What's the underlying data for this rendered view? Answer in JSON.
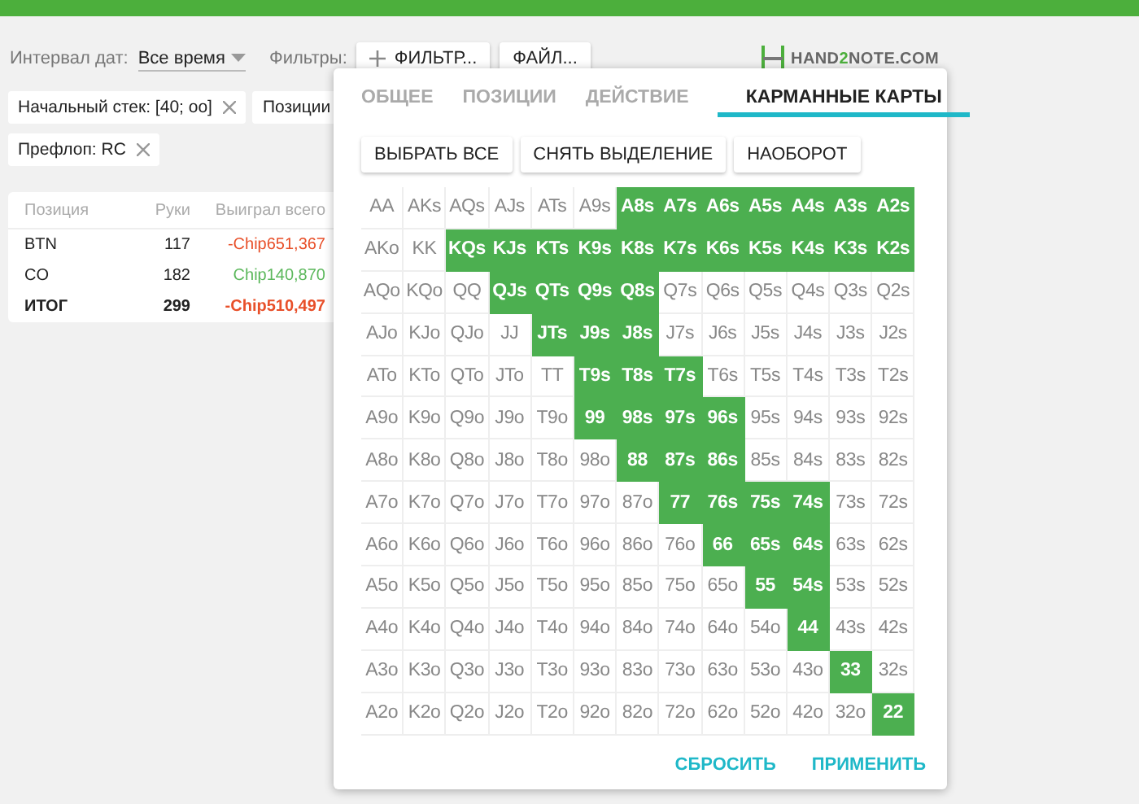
{
  "toolbar": {
    "date_label": "Интервал дат:",
    "date_value": "Все время",
    "filters_label": "Фильтры:",
    "filter_button": "ФИЛЬТР...",
    "file_button": "ФАЙЛ..."
  },
  "logo": {
    "before": "HAND",
    "mark": "2",
    "after": "NOTE.COM"
  },
  "chips": [
    {
      "label": "Начальный стек: [40; oo]",
      "closable": true
    },
    {
      "label": "Позиции",
      "closable": false
    },
    {
      "label": "Префлоп: RC",
      "closable": true
    }
  ],
  "table": {
    "columns": [
      "Позиция",
      "Руки",
      "Выиграл всего"
    ],
    "rows": [
      {
        "kind": "position",
        "position": "BTN",
        "hands": "117",
        "won": "-Chip651,367",
        "color": "#e8502a"
      },
      {
        "kind": "position",
        "position": "CO",
        "hands": "182",
        "won": "Chip140,870",
        "color": "#5cb85c"
      },
      {
        "kind": "total",
        "position": "ИТОГ",
        "hands": "299",
        "won": "-Chip510,497",
        "color": "#e8502a"
      }
    ]
  },
  "popup": {
    "tabs": [
      {
        "label": "ОБЩЕЕ",
        "selected": false
      },
      {
        "label": "ПОЗИЦИИ",
        "selected": false
      },
      {
        "label": "ДЕЙСТВИЕ",
        "selected": false
      },
      {
        "label": "КАРМАННЫЕ КАРТЫ",
        "selected": true
      }
    ],
    "actions": [
      "ВЫБРАТЬ ВСЕ",
      "СНЯТЬ ВЫДЕЛЕНИЕ",
      "НАОБОРОТ"
    ],
    "grid": [
      [
        {
          "label": "AA",
          "selected": false
        },
        {
          "label": "AKs",
          "selected": false
        },
        {
          "label": "AQs",
          "selected": false
        },
        {
          "label": "AJs",
          "selected": false
        },
        {
          "label": "ATs",
          "selected": false
        },
        {
          "label": "A9s",
          "selected": false
        },
        {
          "label": "A8s",
          "selected": true
        },
        {
          "label": "A7s",
          "selected": true
        },
        {
          "label": "A6s",
          "selected": true
        },
        {
          "label": "A5s",
          "selected": true
        },
        {
          "label": "A4s",
          "selected": true
        },
        {
          "label": "A3s",
          "selected": true
        },
        {
          "label": "A2s",
          "selected": true
        }
      ],
      [
        {
          "label": "AKo",
          "selected": false
        },
        {
          "label": "KK",
          "selected": false
        },
        {
          "label": "KQs",
          "selected": true
        },
        {
          "label": "KJs",
          "selected": true
        },
        {
          "label": "KTs",
          "selected": true
        },
        {
          "label": "K9s",
          "selected": true
        },
        {
          "label": "K8s",
          "selected": true
        },
        {
          "label": "K7s",
          "selected": true
        },
        {
          "label": "K6s",
          "selected": true
        },
        {
          "label": "K5s",
          "selected": true
        },
        {
          "label": "K4s",
          "selected": true
        },
        {
          "label": "K3s",
          "selected": true
        },
        {
          "label": "K2s",
          "selected": true
        }
      ],
      [
        {
          "label": "AQo",
          "selected": false
        },
        {
          "label": "KQo",
          "selected": false
        },
        {
          "label": "QQ",
          "selected": false
        },
        {
          "label": "QJs",
          "selected": true
        },
        {
          "label": "QTs",
          "selected": true
        },
        {
          "label": "Q9s",
          "selected": true
        },
        {
          "label": "Q8s",
          "selected": true
        },
        {
          "label": "Q7s",
          "selected": false
        },
        {
          "label": "Q6s",
          "selected": false
        },
        {
          "label": "Q5s",
          "selected": false
        },
        {
          "label": "Q4s",
          "selected": false
        },
        {
          "label": "Q3s",
          "selected": false
        },
        {
          "label": "Q2s",
          "selected": false
        }
      ],
      [
        {
          "label": "AJo",
          "selected": false
        },
        {
          "label": "KJo",
          "selected": false
        },
        {
          "label": "QJo",
          "selected": false
        },
        {
          "label": "JJ",
          "selected": false
        },
        {
          "label": "JTs",
          "selected": true
        },
        {
          "label": "J9s",
          "selected": true
        },
        {
          "label": "J8s",
          "selected": true
        },
        {
          "label": "J7s",
          "selected": false
        },
        {
          "label": "J6s",
          "selected": false
        },
        {
          "label": "J5s",
          "selected": false
        },
        {
          "label": "J4s",
          "selected": false
        },
        {
          "label": "J3s",
          "selected": false
        },
        {
          "label": "J2s",
          "selected": false
        }
      ],
      [
        {
          "label": "ATo",
          "selected": false
        },
        {
          "label": "KTo",
          "selected": false
        },
        {
          "label": "QTo",
          "selected": false
        },
        {
          "label": "JTo",
          "selected": false
        },
        {
          "label": "TT",
          "selected": false
        },
        {
          "label": "T9s",
          "selected": true
        },
        {
          "label": "T8s",
          "selected": true
        },
        {
          "label": "T7s",
          "selected": true
        },
        {
          "label": "T6s",
          "selected": false
        },
        {
          "label": "T5s",
          "selected": false
        },
        {
          "label": "T4s",
          "selected": false
        },
        {
          "label": "T3s",
          "selected": false
        },
        {
          "label": "T2s",
          "selected": false
        }
      ],
      [
        {
          "label": "A9o",
          "selected": false
        },
        {
          "label": "K9o",
          "selected": false
        },
        {
          "label": "Q9o",
          "selected": false
        },
        {
          "label": "J9o",
          "selected": false
        },
        {
          "label": "T9o",
          "selected": false
        },
        {
          "label": "99",
          "selected": true
        },
        {
          "label": "98s",
          "selected": true
        },
        {
          "label": "97s",
          "selected": true
        },
        {
          "label": "96s",
          "selected": true
        },
        {
          "label": "95s",
          "selected": false
        },
        {
          "label": "94s",
          "selected": false
        },
        {
          "label": "93s",
          "selected": false
        },
        {
          "label": "92s",
          "selected": false
        }
      ],
      [
        {
          "label": "A8o",
          "selected": false
        },
        {
          "label": "K8o",
          "selected": false
        },
        {
          "label": "Q8o",
          "selected": false
        },
        {
          "label": "J8o",
          "selected": false
        },
        {
          "label": "T8o",
          "selected": false
        },
        {
          "label": "98o",
          "selected": false
        },
        {
          "label": "88",
          "selected": true
        },
        {
          "label": "87s",
          "selected": true
        },
        {
          "label": "86s",
          "selected": true
        },
        {
          "label": "85s",
          "selected": false
        },
        {
          "label": "84s",
          "selected": false
        },
        {
          "label": "83s",
          "selected": false
        },
        {
          "label": "82s",
          "selected": false
        }
      ],
      [
        {
          "label": "A7o",
          "selected": false
        },
        {
          "label": "K7o",
          "selected": false
        },
        {
          "label": "Q7o",
          "selected": false
        },
        {
          "label": "J7o",
          "selected": false
        },
        {
          "label": "T7o",
          "selected": false
        },
        {
          "label": "97o",
          "selected": false
        },
        {
          "label": "87o",
          "selected": false
        },
        {
          "label": "77",
          "selected": true
        },
        {
          "label": "76s",
          "selected": true
        },
        {
          "label": "75s",
          "selected": true
        },
        {
          "label": "74s",
          "selected": true
        },
        {
          "label": "73s",
          "selected": false
        },
        {
          "label": "72s",
          "selected": false
        }
      ],
      [
        {
          "label": "A6o",
          "selected": false
        },
        {
          "label": "K6o",
          "selected": false
        },
        {
          "label": "Q6o",
          "selected": false
        },
        {
          "label": "J6o",
          "selected": false
        },
        {
          "label": "T6o",
          "selected": false
        },
        {
          "label": "96o",
          "selected": false
        },
        {
          "label": "86o",
          "selected": false
        },
        {
          "label": "76o",
          "selected": false
        },
        {
          "label": "66",
          "selected": true
        },
        {
          "label": "65s",
          "selected": true
        },
        {
          "label": "64s",
          "selected": true
        },
        {
          "label": "63s",
          "selected": false
        },
        {
          "label": "62s",
          "selected": false
        }
      ],
      [
        {
          "label": "A5o",
          "selected": false
        },
        {
          "label": "K5o",
          "selected": false
        },
        {
          "label": "Q5o",
          "selected": false
        },
        {
          "label": "J5o",
          "selected": false
        },
        {
          "label": "T5o",
          "selected": false
        },
        {
          "label": "95o",
          "selected": false
        },
        {
          "label": "85o",
          "selected": false
        },
        {
          "label": "75o",
          "selected": false
        },
        {
          "label": "65o",
          "selected": false
        },
        {
          "label": "55",
          "selected": true
        },
        {
          "label": "54s",
          "selected": true
        },
        {
          "label": "53s",
          "selected": false
        },
        {
          "label": "52s",
          "selected": false
        }
      ],
      [
        {
          "label": "A4o",
          "selected": false
        },
        {
          "label": "K4o",
          "selected": false
        },
        {
          "label": "Q4o",
          "selected": false
        },
        {
          "label": "J4o",
          "selected": false
        },
        {
          "label": "T4o",
          "selected": false
        },
        {
          "label": "94o",
          "selected": false
        },
        {
          "label": "84o",
          "selected": false
        },
        {
          "label": "74o",
          "selected": false
        },
        {
          "label": "64o",
          "selected": false
        },
        {
          "label": "54o",
          "selected": false
        },
        {
          "label": "44",
          "selected": true
        },
        {
          "label": "43s",
          "selected": false
        },
        {
          "label": "42s",
          "selected": false
        }
      ],
      [
        {
          "label": "A3o",
          "selected": false
        },
        {
          "label": "K3o",
          "selected": false
        },
        {
          "label": "Q3o",
          "selected": false
        },
        {
          "label": "J3o",
          "selected": false
        },
        {
          "label": "T3o",
          "selected": false
        },
        {
          "label": "93o",
          "selected": false
        },
        {
          "label": "83o",
          "selected": false
        },
        {
          "label": "73o",
          "selected": false
        },
        {
          "label": "63o",
          "selected": false
        },
        {
          "label": "53o",
          "selected": false
        },
        {
          "label": "43o",
          "selected": false
        },
        {
          "label": "33",
          "selected": true
        },
        {
          "label": "32s",
          "selected": false
        }
      ],
      [
        {
          "label": "A2o",
          "selected": false
        },
        {
          "label": "K2o",
          "selected": false
        },
        {
          "label": "Q2o",
          "selected": false
        },
        {
          "label": "J2o",
          "selected": false
        },
        {
          "label": "T2o",
          "selected": false
        },
        {
          "label": "92o",
          "selected": false
        },
        {
          "label": "82o",
          "selected": false
        },
        {
          "label": "72o",
          "selected": false
        },
        {
          "label": "62o",
          "selected": false
        },
        {
          "label": "52o",
          "selected": false
        },
        {
          "label": "42o",
          "selected": false
        },
        {
          "label": "32o",
          "selected": false
        },
        {
          "label": "22",
          "selected": true
        }
      ]
    ],
    "footer": [
      "СБРОСИТЬ",
      "ПРИМЕНИТЬ"
    ]
  }
}
